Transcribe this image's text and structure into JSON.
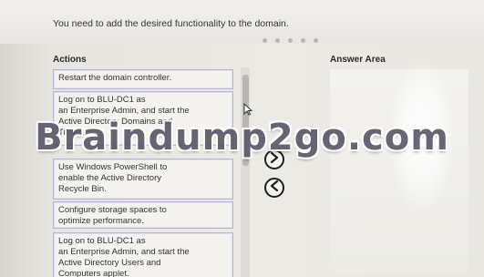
{
  "instruction": "You need to add the desired functionality to the domain.",
  "actions_header": "Actions",
  "answer_header": "Answer Area",
  "actions": [
    "Restart the domain controller.",
    "Log on to BLU-DC1 as\nan Enterprise Admin, and start the\nActive Directory Domains and\nTrusts.",
    "Use Windows PowerShell to\nenable the Active Directory\nRecycle Bin.",
    "Configure storage spaces to\noptimize performance.",
    "Log on to BLU-DC1 as\nan Enterprise Admin, and start the\nActive Directory Users and\nComputers applet."
  ],
  "watermark": "Braindump2go.com",
  "icons": {
    "move_right": "chevron-right-circle-icon",
    "move_left": "chevron-left-circle-icon",
    "cursor": "mouse-pointer-icon"
  },
  "colors": {
    "item_border": "#b9b3d2",
    "item_background": "#f4f3ef",
    "button_border": "#1e1e1e"
  }
}
